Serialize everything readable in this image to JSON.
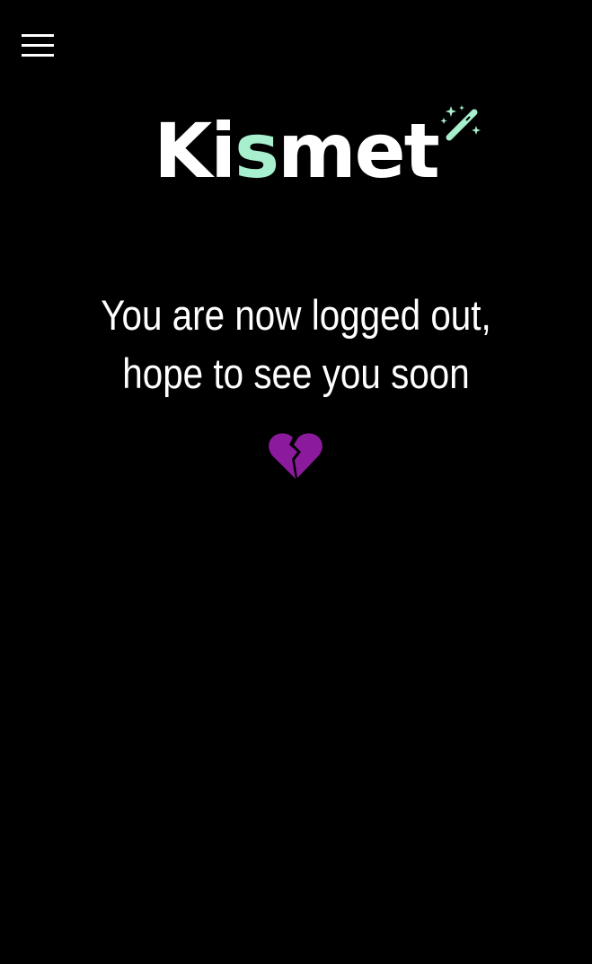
{
  "header": {
    "menu_icon": "hamburger-menu-icon"
  },
  "logo": {
    "part_before": "Ki",
    "part_accent": "s",
    "part_after": "met",
    "accent_color": "#a8f0cd",
    "text_color": "#ffffff",
    "sparkle_icon": "magic-wand-sparkles-icon"
  },
  "main": {
    "message": "You are now logged out, hope to see you soon",
    "heart_icon": "broken-heart-icon",
    "heart_color": "#8b1a9c"
  },
  "theme": {
    "background": "#000000"
  }
}
